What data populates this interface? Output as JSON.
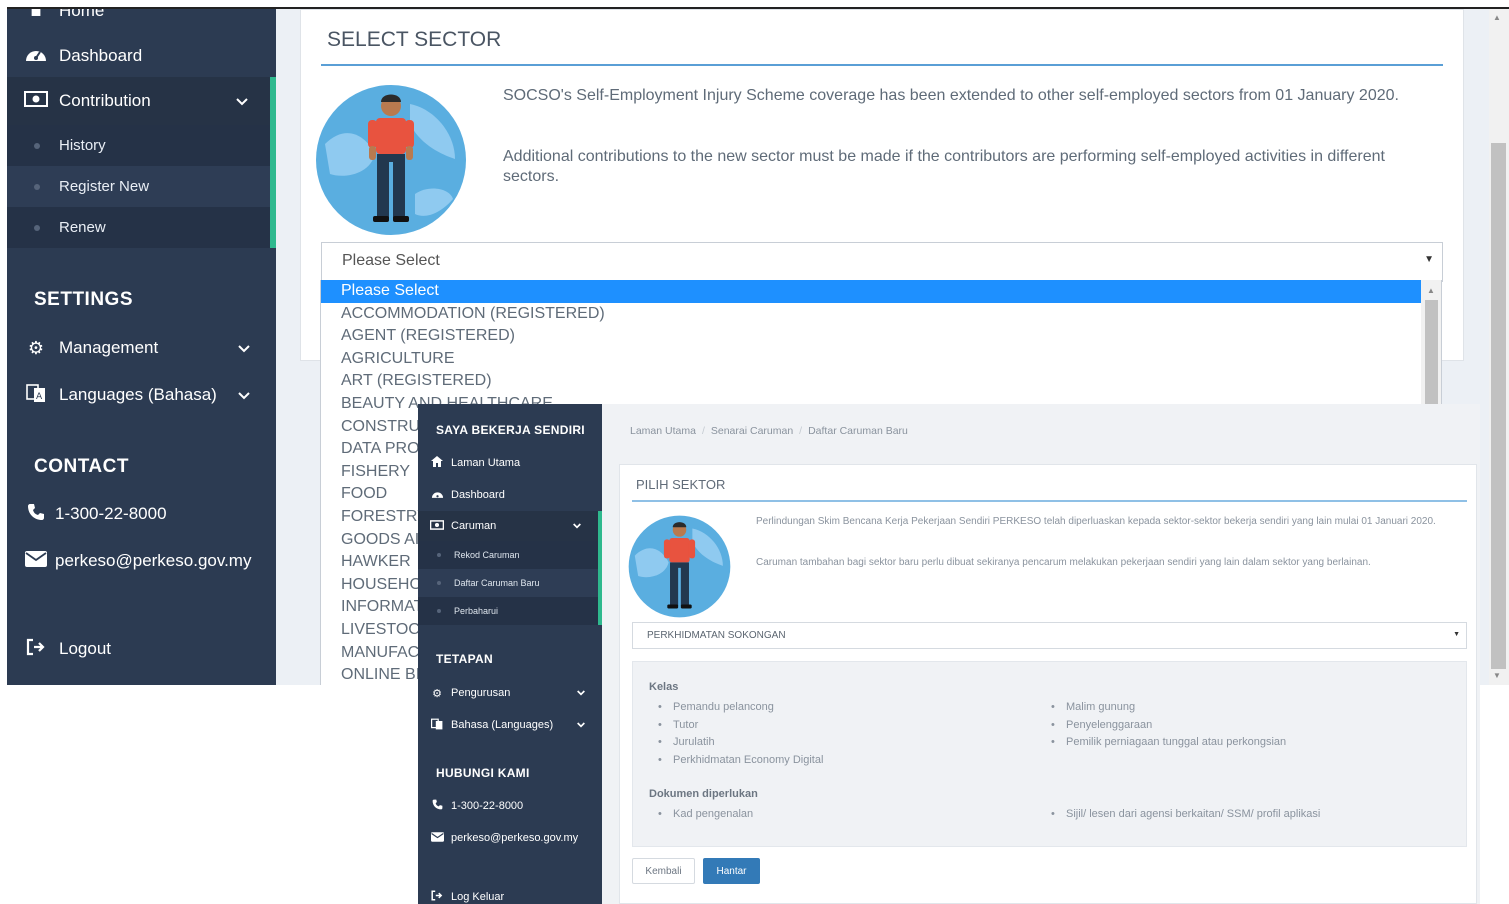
{
  "screen1": {
    "sidebar": {
      "home_label": "Home",
      "items": [
        {
          "label": "Dashboard",
          "icon": "dashboard-icon"
        },
        {
          "label": "Contribution",
          "icon": "money-icon"
        }
      ],
      "sub_items": [
        {
          "label": "History"
        },
        {
          "label": "Register New"
        },
        {
          "label": "Renew"
        }
      ],
      "settings_heading": "SETTINGS",
      "settings_items": [
        {
          "label": "Management",
          "icon": "gear-icon"
        },
        {
          "label": "Languages (Bahasa)",
          "icon": "language-icon"
        }
      ],
      "contact_heading": "CONTACT",
      "phone": "1-300-22-8000",
      "email": "perkeso@perkeso.gov.my",
      "logout_label": "Logout"
    },
    "panel": {
      "title": "SELECT SECTOR",
      "paragraph1": "SOCSO's Self-Employment Injury Scheme coverage has been extended to other self-employed sectors from 01 January 2020.",
      "paragraph2": "Additional contributions to the new sector must be made if the contributors are performing self-employed activities in different sectors.",
      "select_value": "Please Select"
    },
    "dropdown_options": [
      "Please Select",
      "ACCOMMODATION (REGISTERED)",
      "AGENT (REGISTERED)",
      "AGRICULTURE",
      "ART (REGISTERED)",
      "BEAUTY AND HEALTHCARE",
      "CONSTRU",
      "DATA PRO",
      "FISHERY",
      "FOOD",
      "FORESTRY",
      "GOODS AI",
      "HAWKER",
      "HOUSEHO",
      "INFORMAT",
      "LIVESTOCI",
      "MANUFAC",
      "ONLINE BI"
    ],
    "colors": {
      "sidebar": "#2c3b52",
      "accent": "#1e90ff",
      "highlight": "#2fb98e"
    }
  },
  "screen2": {
    "sidebar": {
      "brand": "SAYA BEKERJA SENDIRI",
      "items": [
        {
          "label": "Laman Utama",
          "icon": "home-icon"
        },
        {
          "label": "Dashboard",
          "icon": "dashboard-icon"
        },
        {
          "label": "Caruman",
          "icon": "money-icon"
        }
      ],
      "sub_items": [
        {
          "label": "Rekod Caruman"
        },
        {
          "label": "Daftar Caruman Baru"
        },
        {
          "label": "Perbaharui"
        }
      ],
      "settings_heading": "TETAPAN",
      "settings_items": [
        {
          "label": "Pengurusan",
          "icon": "gear-icon"
        },
        {
          "label": "Bahasa (Languages)",
          "icon": "language-icon"
        }
      ],
      "contact_heading": "HUBUNGI KAMI",
      "phone": "1-300-22-8000",
      "email": "perkeso@perkeso.gov.my",
      "logout_label": "Log Keluar"
    },
    "breadcrumb": [
      "Laman Utama",
      "Senarai Caruman",
      "Daftar Caruman Baru"
    ],
    "panel": {
      "title": "PILIH SEKTOR",
      "paragraph1": "Perlindungan Skim Bencana Kerja Pekerjaan Sendiri PERKESO telah diperluaskan kepada sektor-sektor bekerja sendiri yang lain mulai 01 Januari 2020.",
      "paragraph2": "Caruman tambahan bagi sektor baru perlu dibuat sekiranya pencarum melakukan pekerjaan sendiri yang lain dalam sektor yang berlainan.",
      "select_value": "PERKHIDMATAN SOKONGAN",
      "kelas_heading": "Kelas",
      "kelas_left": [
        "Pemandu pelancong",
        "Tutor",
        "Jurulatih",
        "Perkhidmatan Economy Digital"
      ],
      "kelas_right": [
        "Malim gunung",
        "Penyelenggaraan",
        "Pemilik perniagaan tunggal atau perkongsian"
      ],
      "dokumen_heading": "Dokumen diperlukan",
      "dokumen_left": [
        "Kad pengenalan"
      ],
      "dokumen_right": [
        "Sijil/ lesen dari agensi berkaitan/ SSM/ profil aplikasi"
      ],
      "back_label": "Kembali",
      "submit_label": "Hantar"
    }
  }
}
